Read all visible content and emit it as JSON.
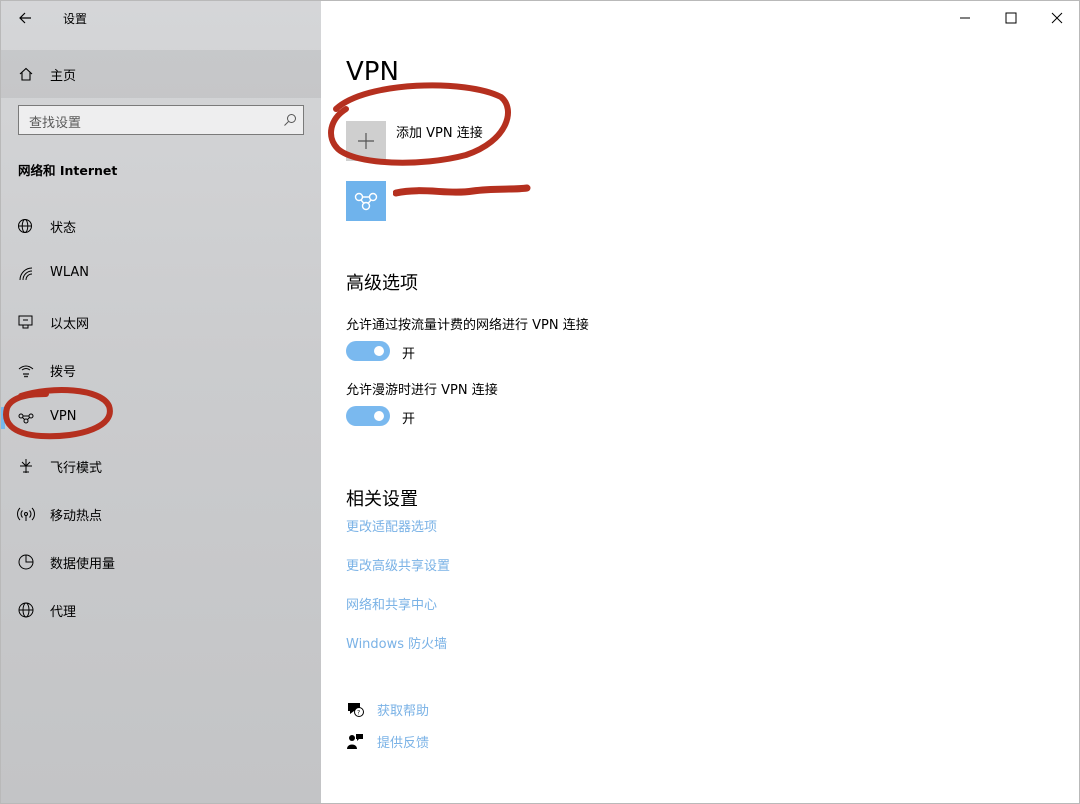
{
  "window": {
    "title": "设置"
  },
  "sidebar": {
    "home_label": "主页",
    "search_placeholder": "查找设置",
    "section_title": "网络和 Internet",
    "items": [
      {
        "label": "状态",
        "icon": "globe-status-icon"
      },
      {
        "label": "WLAN",
        "icon": "wifi-icon"
      },
      {
        "label": "以太网",
        "icon": "ethernet-icon"
      },
      {
        "label": "拨号",
        "icon": "dialup-icon"
      },
      {
        "label": "VPN",
        "icon": "vpn-icon",
        "selected": true
      },
      {
        "label": "飞行模式",
        "icon": "airplane-icon"
      },
      {
        "label": "移动热点",
        "icon": "hotspot-icon"
      },
      {
        "label": "数据使用量",
        "icon": "data-usage-icon"
      },
      {
        "label": "代理",
        "icon": "globe-icon"
      }
    ]
  },
  "main": {
    "title": "VPN",
    "add_vpn_label": "添加 VPN 连接",
    "connection_name": "",
    "advanced": {
      "heading": "高级选项",
      "options": [
        {
          "label": "允许通过按流量计费的网络进行 VPN 连接",
          "state": "开",
          "on": true
        },
        {
          "label": "允许漫游时进行 VPN 连接",
          "state": "开",
          "on": true
        }
      ]
    },
    "related": {
      "heading": "相关设置",
      "links": [
        "更改适配器选项",
        "更改高级共享设置",
        "网络和共享中心",
        "Windows 防火墙"
      ]
    },
    "help": {
      "get_help": "获取帮助",
      "feedback": "提供反馈"
    }
  },
  "colors": {
    "accent": "#76b9ed",
    "link": "#7ab2e6",
    "annotation": "#b5301f"
  }
}
